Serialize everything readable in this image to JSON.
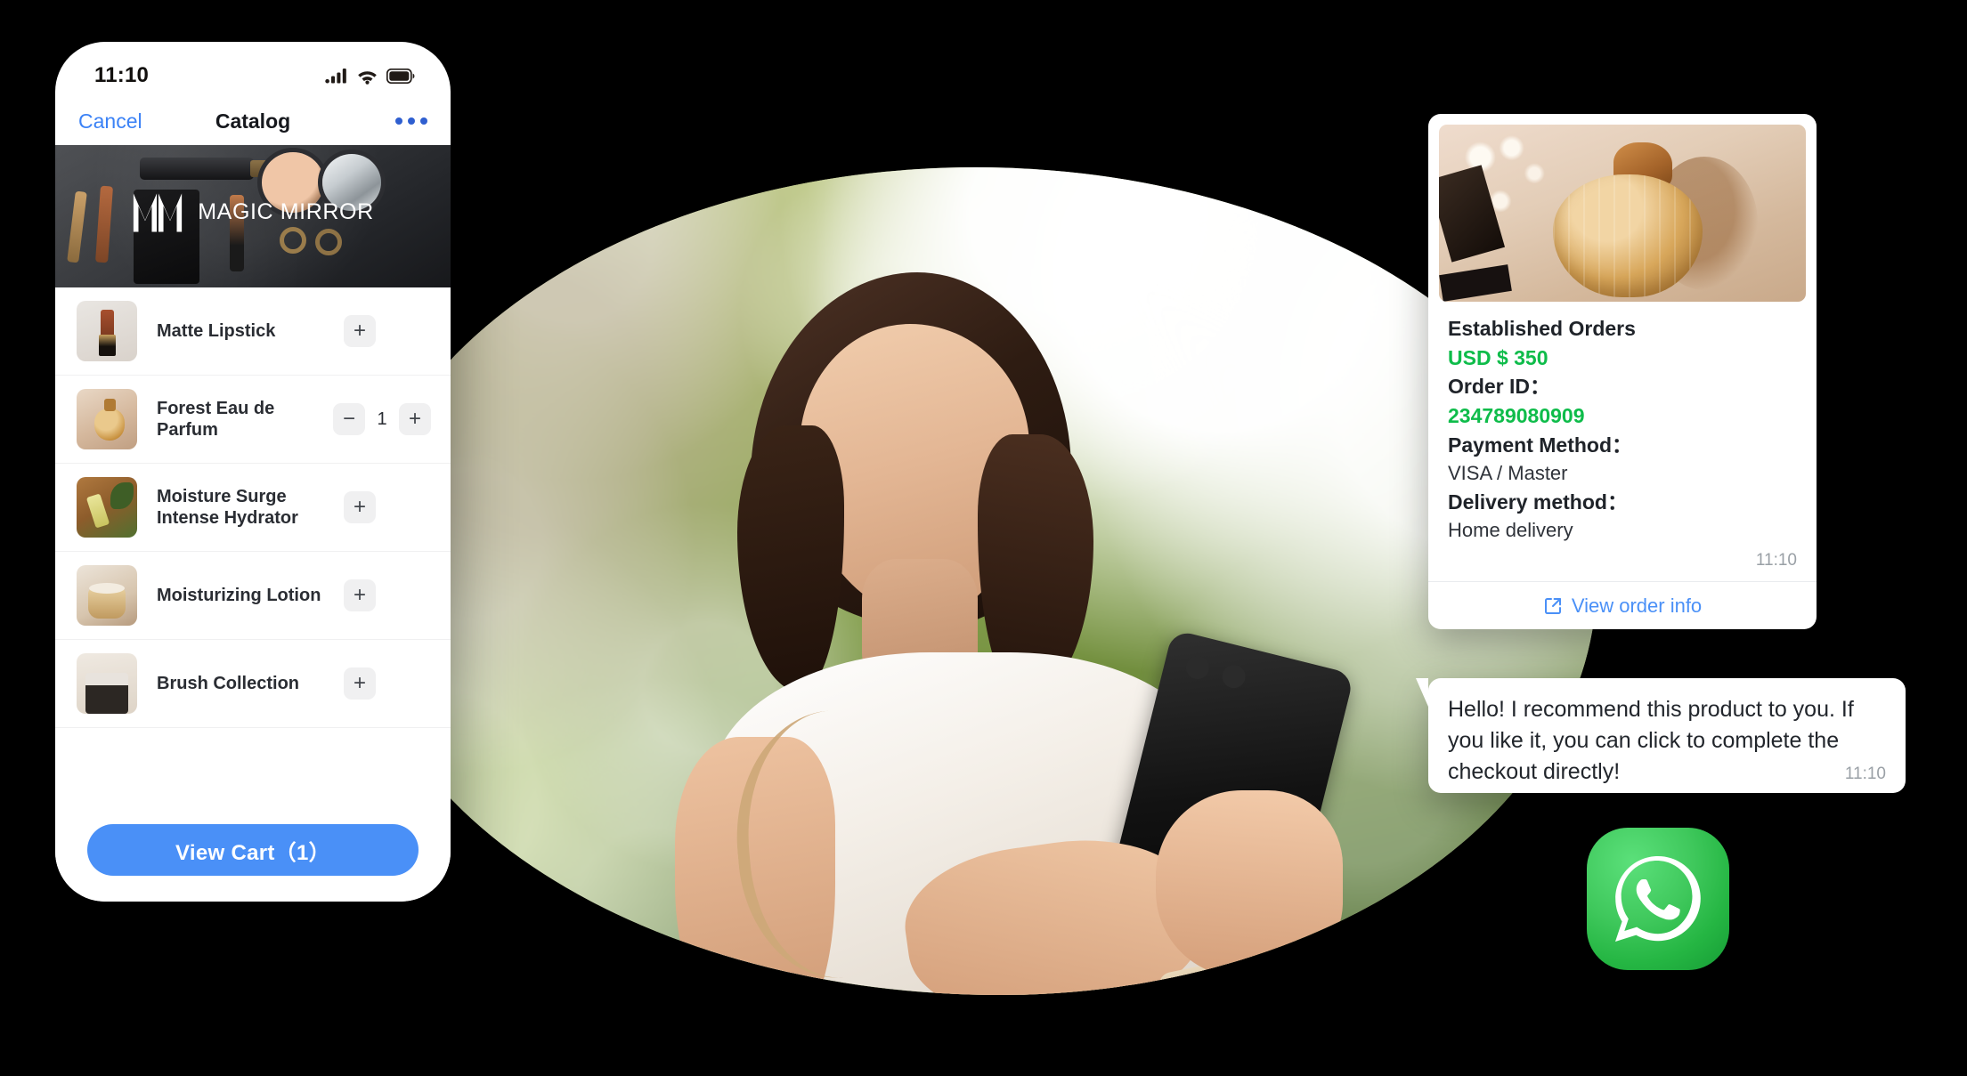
{
  "phone": {
    "status_bar": {
      "time": "11:10",
      "signal_icon": "cellular-signal-icon",
      "wifi_icon": "wifi-icon",
      "battery_icon": "battery-icon"
    },
    "nav": {
      "cancel_label": "Cancel",
      "title": "Catalog",
      "more_icon": "more-options-icon"
    },
    "banner": {
      "brand_name": "MAGIC MIRROR",
      "logo_icon": "magic-mirror-monogram-icon"
    },
    "products": [
      {
        "name": "Matte Lipstick",
        "thumb": "matte-lipstick-thumb",
        "qty": null,
        "add_label": "+"
      },
      {
        "name": "Forest Eau de Parfum",
        "thumb": "forest-parfum-thumb",
        "qty": "1",
        "add_label": "+",
        "remove_label": "−"
      },
      {
        "name": "Moisture Surge Intense Hydrator",
        "thumb": "moisture-surge-thumb",
        "qty": null,
        "add_label": "+"
      },
      {
        "name": "Moisturizing Lotion",
        "thumb": "moisturizing-lotion-thumb",
        "qty": null,
        "add_label": "+"
      },
      {
        "name": "Brush Collection",
        "thumb": "brush-collection-thumb",
        "qty": null,
        "add_label": "+"
      }
    ],
    "cart_button_label": "View Cart（1）"
  },
  "order_card": {
    "product_image": "perfume-bottle-photo",
    "title": "Established Orders",
    "amount": "USD  $ 350",
    "order_id_label": "Order ID：",
    "order_id_value": "234789080909",
    "payment_label": "Payment Method：",
    "payment_value": "VISA / Master",
    "delivery_label": "Delivery method：",
    "delivery_value": "Home delivery",
    "time": "11:10",
    "footer_link_label": "View order info",
    "footer_link_icon": "external-link-icon"
  },
  "chat": {
    "message": "Hello! I recommend this product to you. If you like it, you can click to complete the checkout directly!",
    "time": "11:10"
  },
  "whatsapp": {
    "logo_icon": "whatsapp-logo-icon"
  },
  "colors": {
    "accent_blue": "#4a90f7",
    "link_blue": "#3b82f6",
    "success_green": "#0ebc4a",
    "whatsapp_green": "#25b643",
    "background": "#000000"
  }
}
